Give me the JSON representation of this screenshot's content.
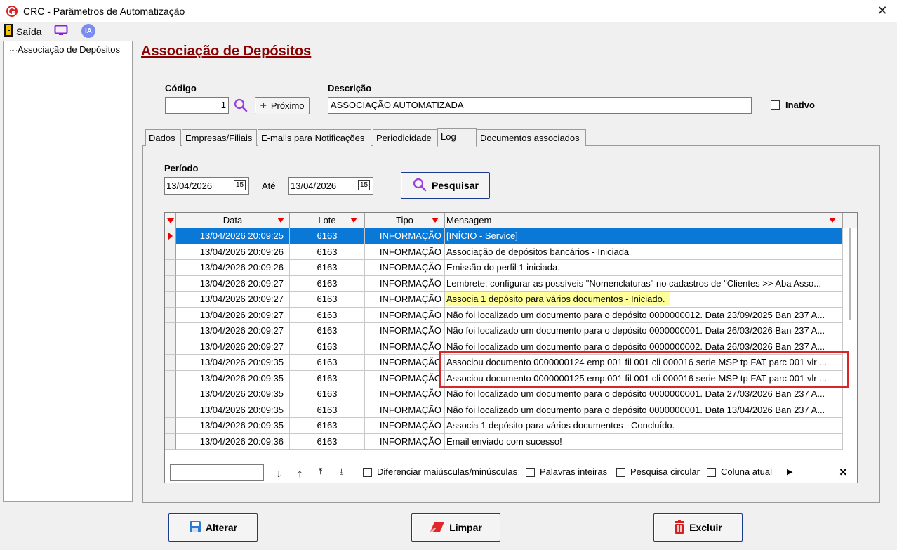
{
  "window": {
    "title": "CRC - Parâmetros de Automatização"
  },
  "menu": {
    "exit_label": "Saída",
    "ia_label": "IA"
  },
  "tree": {
    "items": [
      {
        "label": "Associação de Depósitos"
      }
    ]
  },
  "page": {
    "title": "Associação de Depósitos"
  },
  "form": {
    "codigo_label": "Código",
    "codigo_value": "1",
    "next_label": "Próximo",
    "descricao_label": "Descrição",
    "descricao_value": "ASSOCIAÇÃO AUTOMATIZADA",
    "inativo_label": "Inativo"
  },
  "tabs": [
    {
      "label": "Dados"
    },
    {
      "label": "Empresas/Filiais"
    },
    {
      "label": "E-mails para Notificações"
    },
    {
      "label": "Periodicidade"
    },
    {
      "label": "Log",
      "active": true
    },
    {
      "label": "Documentos associados"
    }
  ],
  "log": {
    "periodo_label": "Período",
    "date_from": "13/04/2026",
    "ate_label": "Até",
    "date_to": "13/04/2026",
    "calendar_glyph": "15",
    "search_button": "Pesquisar",
    "columns": {
      "data": "Data",
      "lote": "Lote",
      "tipo": "Tipo",
      "mensagem": "Mensagem"
    },
    "rows": [
      {
        "data": "13/04/2026 20:09:25",
        "lote": "6163",
        "tipo": "INFORMAÇÃO",
        "mensagem": "[INÍCIO - Service]"
      },
      {
        "data": "13/04/2026 20:09:26",
        "lote": "6163",
        "tipo": "INFORMAÇÃO",
        "mensagem": "Associação de depósitos bancários - Iniciada"
      },
      {
        "data": "13/04/2026 20:09:26",
        "lote": "6163",
        "tipo": "INFORMAÇÃO",
        "mensagem": "Emissão do perfil 1 iniciada."
      },
      {
        "data": "13/04/2026 20:09:27",
        "lote": "6163",
        "tipo": "INFORMAÇÃO",
        "mensagem": "Lembrete: configurar as possíveis \"Nomenclaturas\" no cadastros de \"Clientes >> Aba Asso..."
      },
      {
        "data": "13/04/2026 20:09:27",
        "lote": "6163",
        "tipo": "INFORMAÇÃO",
        "mensagem": "Associa 1 depósito para vários documentos - Iniciado."
      },
      {
        "data": "13/04/2026 20:09:27",
        "lote": "6163",
        "tipo": "INFORMAÇÃO",
        "mensagem": "Não foi localizado um documento para o depósito 0000000012. Data 23/09/2025 Ban 237 A..."
      },
      {
        "data": "13/04/2026 20:09:27",
        "lote": "6163",
        "tipo": "INFORMAÇÃO",
        "mensagem": "Não foi localizado um documento para o depósito 0000000001. Data 26/03/2026 Ban 237 A..."
      },
      {
        "data": "13/04/2026 20:09:27",
        "lote": "6163",
        "tipo": "INFORMAÇÃO",
        "mensagem": "Não foi localizado um documento para o depósito 0000000002. Data 26/03/2026 Ban 237 A..."
      },
      {
        "data": "13/04/2026 20:09:35",
        "lote": "6163",
        "tipo": "INFORMAÇÃO",
        "mensagem": "Associou documento 0000000124 emp 001 fil 001 cli 000016 serie MSP tp FAT parc 001 vlr ..."
      },
      {
        "data": "13/04/2026 20:09:35",
        "lote": "6163",
        "tipo": "INFORMAÇÃO",
        "mensagem": "Associou documento 0000000125 emp 001 fil 001 cli 000016 serie MSP tp FAT parc 001 vlr ..."
      },
      {
        "data": "13/04/2026 20:09:35",
        "lote": "6163",
        "tipo": "INFORMAÇÃO",
        "mensagem": "Não foi localizado um documento para o depósito 0000000001. Data 27/03/2026 Ban 237 A..."
      },
      {
        "data": "13/04/2026 20:09:35",
        "lote": "6163",
        "tipo": "INFORMAÇÃO",
        "mensagem": "Não foi localizado um documento para o depósito 0000000001. Data 13/04/2026 Ban 237 A..."
      },
      {
        "data": "13/04/2026 20:09:35",
        "lote": "6163",
        "tipo": "INFORMAÇÃO",
        "mensagem": "Associa 1 depósito para vários documentos - Concluído."
      },
      {
        "data": "13/04/2026 20:09:36",
        "lote": "6163",
        "tipo": "INFORMAÇÃO",
        "mensagem": "Email enviado com sucesso!"
      }
    ],
    "search_bar": {
      "search_value": "",
      "opt_case": "Diferenciar maiúsculas/minúsculas",
      "opt_words": "Palavras inteiras",
      "opt_circular": "Pesquisa circular",
      "opt_column": "Coluna atual",
      "close_glyph": "×"
    }
  },
  "footer": {
    "alterar": "Alterar",
    "limpar": "Limpar",
    "excluir": "Excluir"
  },
  "colors": {
    "title_red": "#8b0000",
    "selection_blue": "#0a78d7",
    "highlight_yellow": "#ffff99",
    "frame_red": "#d9262b"
  }
}
